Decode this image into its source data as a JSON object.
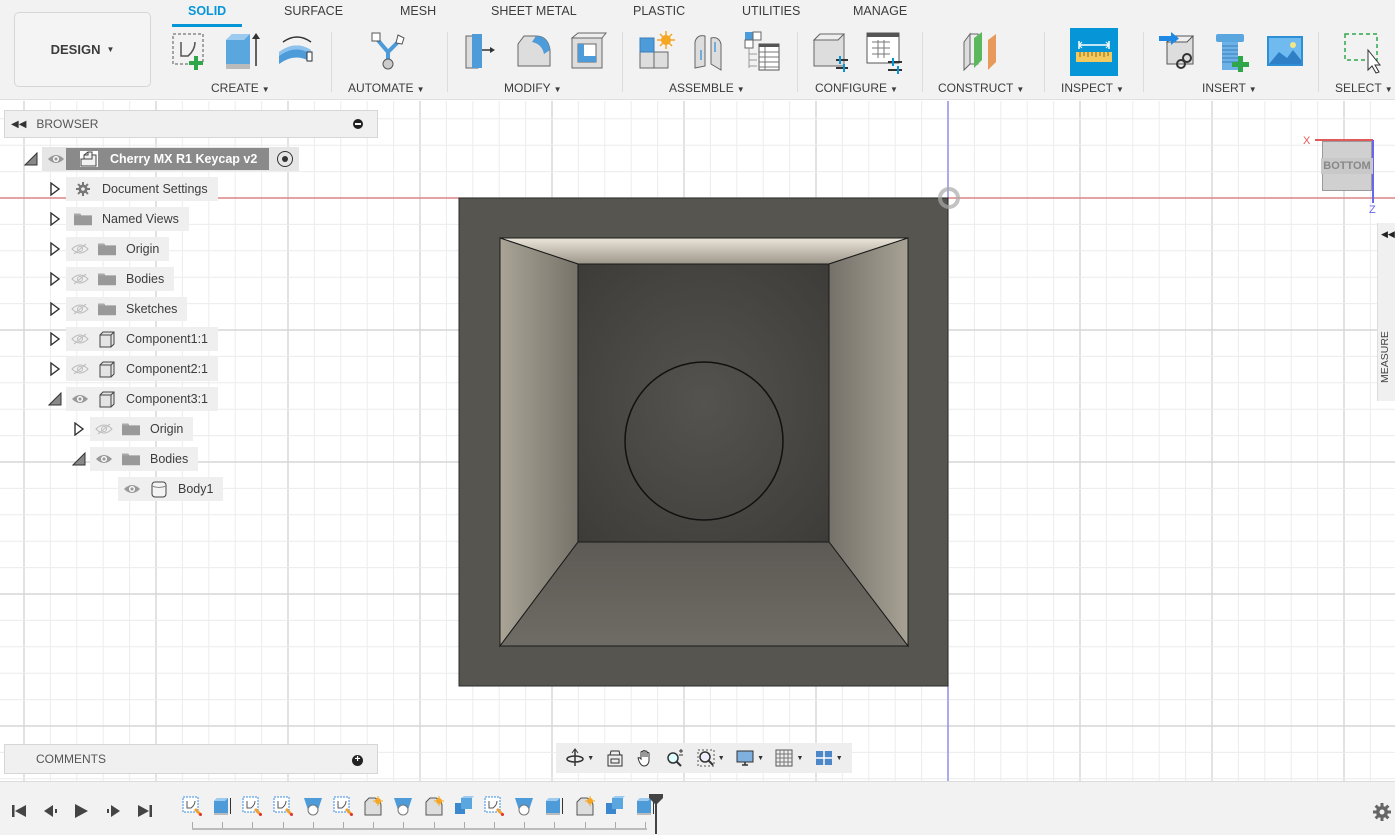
{
  "toolbar": {
    "workspace": "DESIGN",
    "tabs": [
      {
        "label": "SOLID",
        "active": true
      },
      {
        "label": "SURFACE"
      },
      {
        "label": "MESH"
      },
      {
        "label": "SHEET METAL"
      },
      {
        "label": "PLASTIC"
      },
      {
        "label": "UTILITIES"
      },
      {
        "label": "MANAGE"
      }
    ],
    "groups": [
      {
        "label": "CREATE",
        "icons": [
          "create-sketch-icon",
          "extrude-icon",
          "revolve-icon"
        ]
      },
      {
        "label": "AUTOMATE",
        "icons": [
          "automate-icon"
        ]
      },
      {
        "label": "MODIFY",
        "icons": [
          "press-pull-icon",
          "fillet-icon",
          "shell-icon"
        ]
      },
      {
        "label": "ASSEMBLE",
        "icons": [
          "new-component-icon",
          "joint-icon",
          "bill-of-materials-icon"
        ]
      },
      {
        "label": "CONFIGURE",
        "icons": [
          "configure-icon",
          "configuration-table-icon"
        ]
      },
      {
        "label": "CONSTRUCT",
        "icons": [
          "offset-plane-icon"
        ]
      },
      {
        "label": "INSPECT",
        "icons": [
          "measure-icon"
        ]
      },
      {
        "label": "INSERT",
        "icons": [
          "insert-derive-icon",
          "insert-mcmaster-icon",
          "insert-canvas-icon"
        ]
      },
      {
        "label": "SELECT",
        "icons": [
          "window-select-icon"
        ]
      }
    ]
  },
  "browser": {
    "title": "BROWSER",
    "root": {
      "label": "Cherry MX R1 Keycap v2"
    },
    "items": [
      {
        "label": "Document Settings",
        "icon": "gear-icon",
        "visible": null,
        "expanded": false
      },
      {
        "label": "Named Views",
        "icon": "folder-icon",
        "visible": null,
        "expanded": false
      },
      {
        "label": "Origin",
        "icon": "folder-icon",
        "visible": false,
        "expanded": false
      },
      {
        "label": "Bodies",
        "icon": "folder-icon",
        "visible": false,
        "expanded": false
      },
      {
        "label": "Sketches",
        "icon": "folder-icon",
        "visible": false,
        "expanded": false
      },
      {
        "label": "Component1:1",
        "icon": "component-icon",
        "visible": false,
        "expanded": false
      },
      {
        "label": "Component2:1",
        "icon": "component-icon",
        "visible": false,
        "expanded": false
      },
      {
        "label": "Component3:1",
        "icon": "component-icon",
        "visible": true,
        "expanded": true
      },
      {
        "label": "Origin",
        "icon": "folder-icon",
        "visible": false,
        "expanded": false
      },
      {
        "label": "Bodies",
        "icon": "folder-icon",
        "visible": true,
        "expanded": true
      },
      {
        "label": "Body1",
        "icon": "body-icon",
        "visible": true,
        "expanded": null
      }
    ]
  },
  "comments": {
    "title": "COMMENTS"
  },
  "viewcube": {
    "face": "BOTTOM",
    "axis_x": "X",
    "axis_z": "Z"
  },
  "measure_panel": {
    "label": "MEASURE"
  },
  "navbar": {
    "items": [
      "orbit-icon",
      "look-at-icon",
      "pan-icon",
      "zoom-icon",
      "fit-icon",
      "display-settings-icon",
      "grid-settings-icon",
      "viewports-icon"
    ]
  },
  "timeline": {
    "controls": [
      "go-to-start",
      "step-back",
      "play",
      "step-forward",
      "go-to-end"
    ],
    "features": [
      "sketch",
      "extrude",
      "sketch",
      "sketch",
      "hole",
      "sketch",
      "fillet",
      "hole",
      "fillet",
      "combine",
      "sketch",
      "hole",
      "extrude",
      "fillet",
      "combine",
      "extrude"
    ]
  },
  "colors": {
    "accent": "#0696d7",
    "axis_x": "#e05a5a",
    "axis_z": "#6666ee",
    "body_outer": "#575550",
    "body_inner_wall": "#a8a398",
    "body_floor": "#4e4c48"
  }
}
